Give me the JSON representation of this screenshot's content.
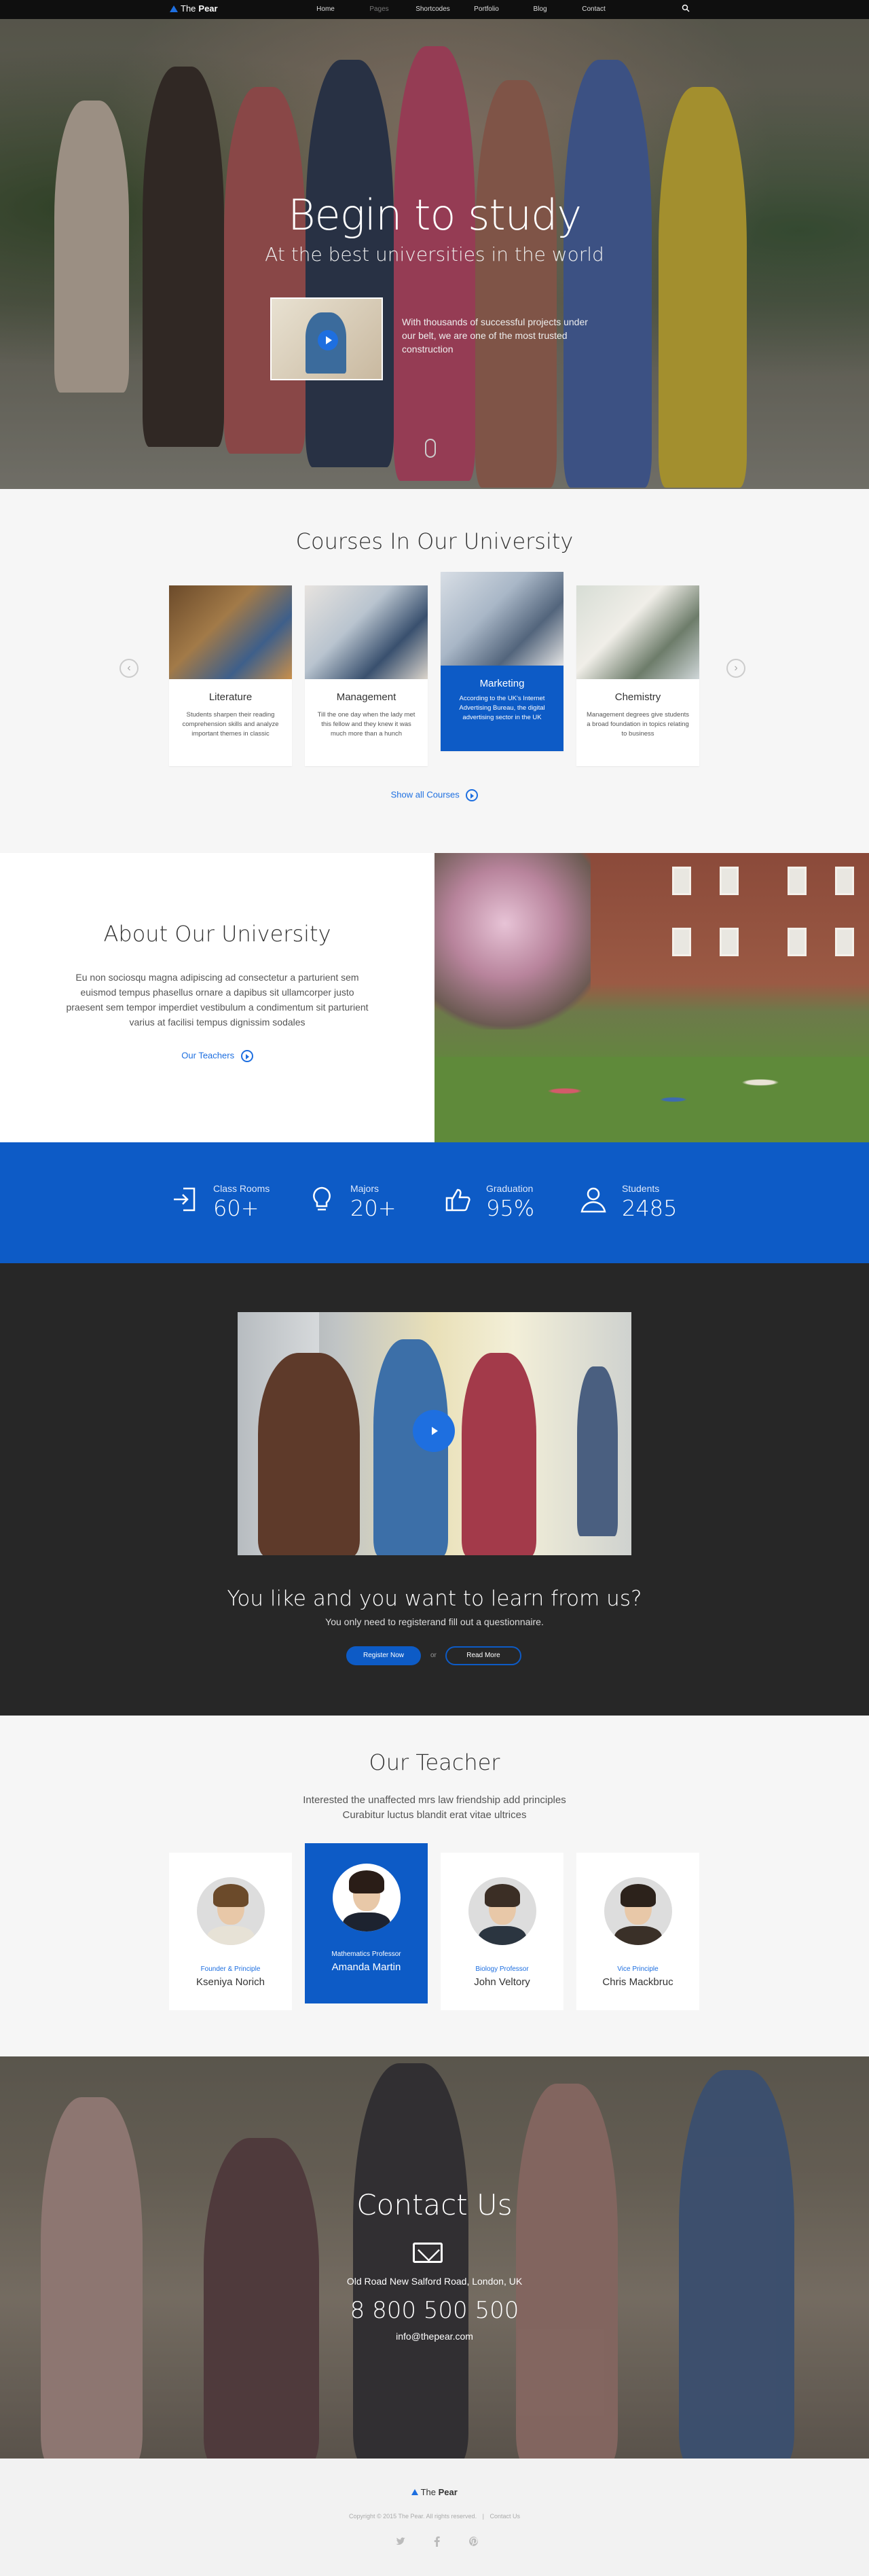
{
  "nav": {
    "logo_prefix": "The",
    "logo_name": "Pear",
    "items": [
      "Home",
      "Pages",
      "Shortcodes",
      "Portfolio",
      "Blog",
      "Contact"
    ]
  },
  "hero": {
    "title": "Begin to study",
    "subtitle": "At the best universities in the world",
    "text": "With thousands of successful projects under our belt, we are one of the most trusted construction"
  },
  "courses": {
    "title": "Courses In Our University",
    "items": [
      {
        "title": "Literature",
        "text": "Students sharpen their reading comprehension skills and analyze important themes in classic"
      },
      {
        "title": "Management",
        "text": "Till the one day when the lady met this fellow and they knew it was much more than a hunch"
      },
      {
        "title": "Marketing",
        "text": "According to the UK's Internet Advertising Bureau, the digital advertising sector in the UK"
      },
      {
        "title": "Chemistry",
        "text": "Management degrees give students a broad foundation in topics relating to business"
      }
    ],
    "show_all": "Show all Courses",
    "prev_arrow": "‹",
    "next_arrow": "›"
  },
  "about": {
    "title": "About Our University",
    "text": "Eu non sociosqu magna adipiscing ad consectetur a parturient sem euismod tempus phasellus ornare a dapibus sit ullamcorper justo praesent sem tempor imperdiet vestibulum a condimentum sit parturient varius at facilisi tempus dignissim sodales",
    "link": "Our Teachers"
  },
  "stats": [
    {
      "label": "Class Rooms",
      "value": "60+",
      "icon": "door-enter-icon"
    },
    {
      "label": "Majors",
      "value": "20+",
      "icon": "lightbulb-icon"
    },
    {
      "label": "Graduation",
      "value": "95%",
      "icon": "thumbs-up-icon"
    },
    {
      "label": "Students",
      "value": "2485",
      "icon": "user-icon"
    }
  ],
  "video": {
    "title": "You like and you want to learn from us?",
    "subtitle": "You only need to registerand fill out a questionnaire.",
    "register_label": "Register Now",
    "or": "or",
    "read_more_label": "Read More"
  },
  "teachers": {
    "title": "Our Teacher",
    "description_line1": "Interested the unaffected mrs law friendship add principles",
    "description_line2": "Curabitur luctus blandit erat vitae ultrices",
    "items": [
      {
        "role": "Founder & Principle",
        "name": "Kseniya Norich"
      },
      {
        "role": "Mathematics Professor",
        "name": "Amanda Martin"
      },
      {
        "role": "Biology Professor",
        "name": "John Veltory"
      },
      {
        "role": "Vice Principle",
        "name": "Chris Mackbruc"
      }
    ]
  },
  "contact": {
    "title": "Contact Us",
    "address": "Old Road New Salford Road, London, UK",
    "phone": "8 800 500 500",
    "email": "info@thepear.com"
  },
  "footer": {
    "logo_prefix": "The",
    "logo_name": "Pear",
    "copyright": "Copyright © 2015 The Pear. All rights reserved.",
    "contact_link": "Contact Us",
    "separator": "|",
    "social": [
      "twitter-icon",
      "facebook-icon",
      "pinterest-icon"
    ]
  },
  "colors": {
    "accent": "#0d5bc6",
    "dark": "#272727",
    "light": "#f6f6f6"
  }
}
